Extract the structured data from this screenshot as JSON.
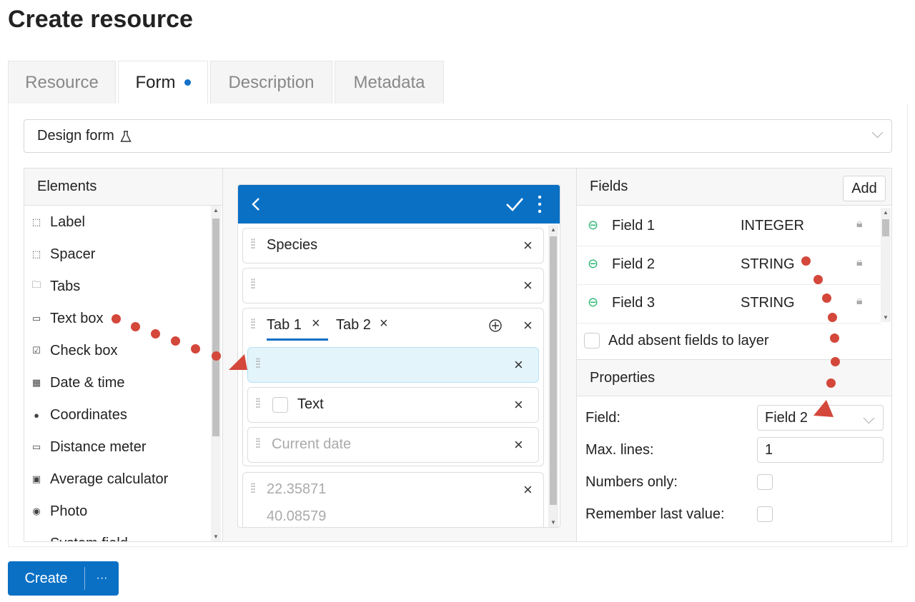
{
  "title": "Create resource",
  "tabs": [
    {
      "label": "Resource"
    },
    {
      "label": "Form"
    },
    {
      "label": "Description"
    },
    {
      "label": "Metadata"
    }
  ],
  "design_select": {
    "label": "Design form",
    "icon": "flask-icon"
  },
  "elements": {
    "header": "Elements",
    "items": [
      {
        "label": "Label",
        "icon": "label-icon"
      },
      {
        "label": "Spacer",
        "icon": "spacer-icon"
      },
      {
        "label": "Tabs",
        "icon": "tabs-icon"
      },
      {
        "label": "Text box",
        "icon": "textbox-icon"
      },
      {
        "label": "Check box",
        "icon": "checkbox-icon"
      },
      {
        "label": "Date & time",
        "icon": "calendar-icon"
      },
      {
        "label": "Coordinates",
        "icon": "location-pin-icon"
      },
      {
        "label": "Distance meter",
        "icon": "ruler-icon"
      },
      {
        "label": "Average calculator",
        "icon": "calculator-icon"
      },
      {
        "label": "Photo",
        "icon": "camera-icon"
      },
      {
        "label": "System field",
        "icon": "system-field-icon"
      }
    ]
  },
  "preview": {
    "species": "Species",
    "tab1": "Tab 1",
    "tab2": "Tab 2",
    "checkbox_text": "Text",
    "date_placeholder": "Current date",
    "coord_lat": "22.35871",
    "coord_lon": "40.08579"
  },
  "fields": {
    "header": "Fields",
    "add_label": "Add",
    "rows": [
      {
        "name": "Field 1",
        "type": "INTEGER"
      },
      {
        "name": "Field 2",
        "type": "STRING"
      },
      {
        "name": "Field 3",
        "type": "STRING"
      }
    ],
    "absent_label": "Add absent fields to layer"
  },
  "properties": {
    "header": "Properties",
    "field_label": "Field",
    "field_value": "Field 2",
    "max_lines_label": "Max. lines",
    "max_lines_value": "1",
    "numbers_only_label": "Numbers only",
    "remember_label": "Remember last value",
    "colon": ":"
  },
  "footer": {
    "create_label": "Create",
    "more_label": "···"
  },
  "colors": {
    "accent": "#0a70c4",
    "annotation": "#d4473b",
    "link_icon": "#2bb673"
  }
}
